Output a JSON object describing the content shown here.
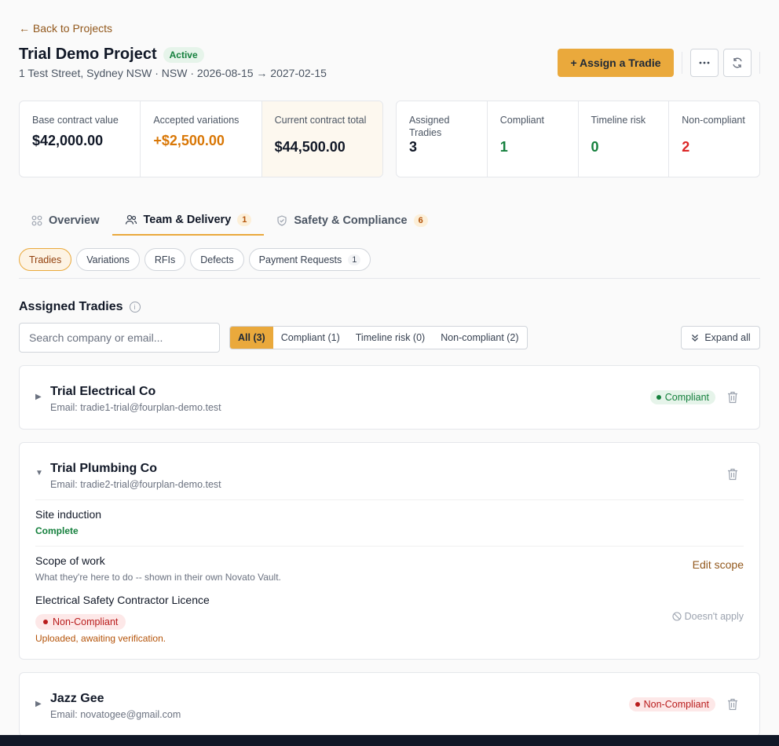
{
  "header": {
    "back_label": "← Back to Projects",
    "title": "Trial Demo Project",
    "status": "Active",
    "subtitle": "1 Test Street, Sydney NSW · NSW · 2026-08-15 → 2027-02-15",
    "assign_label": "+ Assign a Tradie",
    "more_icon": "more-horizontal-icon",
    "refresh_icon": "refresh-icon"
  },
  "contract_stats": [
    {
      "label": "Base contract value",
      "value": "$42,000.00"
    },
    {
      "label": "Accepted variations",
      "value": "+$2,500.00"
    },
    {
      "label": "Current contract total",
      "value": "$44,500.00"
    }
  ],
  "tradie_stats": [
    {
      "label": "Assigned Tradies",
      "value": "3"
    },
    {
      "label": "Compliant",
      "value": "1"
    },
    {
      "label": "Timeline risk",
      "value": "0"
    },
    {
      "label": "Non-compliant",
      "value": "2"
    }
  ],
  "tabs": [
    {
      "label": "Overview",
      "icon": "grid-icon"
    },
    {
      "label": "Team & Delivery",
      "icon": "team-icon",
      "count": "1",
      "active": true
    },
    {
      "label": "Safety & Compliance",
      "icon": "shield-check-icon",
      "count": "6"
    }
  ],
  "subtabs": [
    {
      "label": "Tradies",
      "active": true
    },
    {
      "label": "Variations"
    },
    {
      "label": "RFIs"
    },
    {
      "label": "Defects"
    },
    {
      "label": "Payment Requests",
      "count": "1"
    }
  ],
  "section": {
    "title": "Assigned Tradies",
    "search_placeholder": "Search company or email...",
    "filters": [
      "All (3)",
      "Compliant (1)",
      "Timeline risk (0)",
      "Non-compliant (2)"
    ],
    "expand_label": "Expand all"
  },
  "tradies": [
    {
      "name": "Trial Electrical Co",
      "email": "Email: tradie1-trial@fourplan-demo.test",
      "status": "Compliant",
      "expanded": false
    },
    {
      "name": "Trial Plumbing Co",
      "email": "Email: tradie2-trial@fourplan-demo.test",
      "status": "",
      "expanded": true,
      "details": {
        "induction_title": "Site induction",
        "induction_status": "Complete",
        "scope_title": "Scope of work",
        "scope_desc": "What they're here to do -- shown in their own Novato Vault.",
        "scope_action": "Edit scope",
        "licence_title": "Electrical Safety Contractor Licence",
        "licence_status": "Non-Compliant",
        "licence_note": "Uploaded, awaiting verification.",
        "licence_action": "Doesn't apply"
      }
    },
    {
      "name": "Jazz Gee",
      "email": "Email: novatogee@gmail.com",
      "status": "Non-Compliant",
      "expanded": false
    }
  ],
  "colors": {
    "accent": "#eaa93c",
    "green": "#15803d",
    "red": "#dc2626",
    "orange": "#d97706"
  }
}
